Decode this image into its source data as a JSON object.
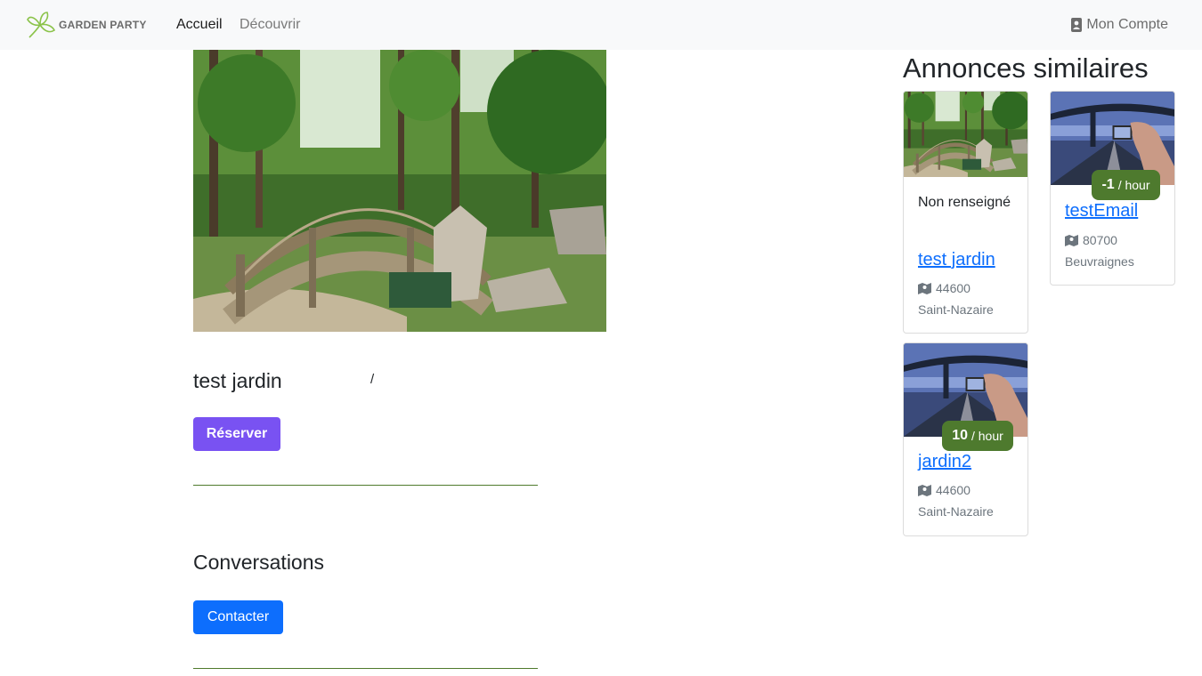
{
  "navbar": {
    "brand": "GARDEN PARTY",
    "home": "Accueil",
    "discover": "Découvrir",
    "account": "Mon Compte"
  },
  "listing": {
    "title": "test jardin",
    "separator": "/",
    "reserve_label": "Réserver"
  },
  "conversations": {
    "title": "Conversations",
    "contact_label": "Contacter"
  },
  "similar": {
    "title": "Annonces similaires",
    "cards": [
      {
        "price_text": "Non renseigné",
        "name": "test jardin",
        "zip": "44600",
        "city": "Saint-Nazaire"
      },
      {
        "price": "-1",
        "unit": "/ hour",
        "name": "testEmail",
        "zip": "80700",
        "city": "Beuvraignes"
      },
      {
        "price": "10",
        "unit": "/ hour",
        "name": "jardin2",
        "zip": "44600",
        "city": "Saint-Nazaire"
      }
    ]
  },
  "colors": {
    "primary": "#0d6efd",
    "reserve": "#7952f2",
    "badge": "#4e7a2e",
    "logo_green": "#8bc34a"
  }
}
